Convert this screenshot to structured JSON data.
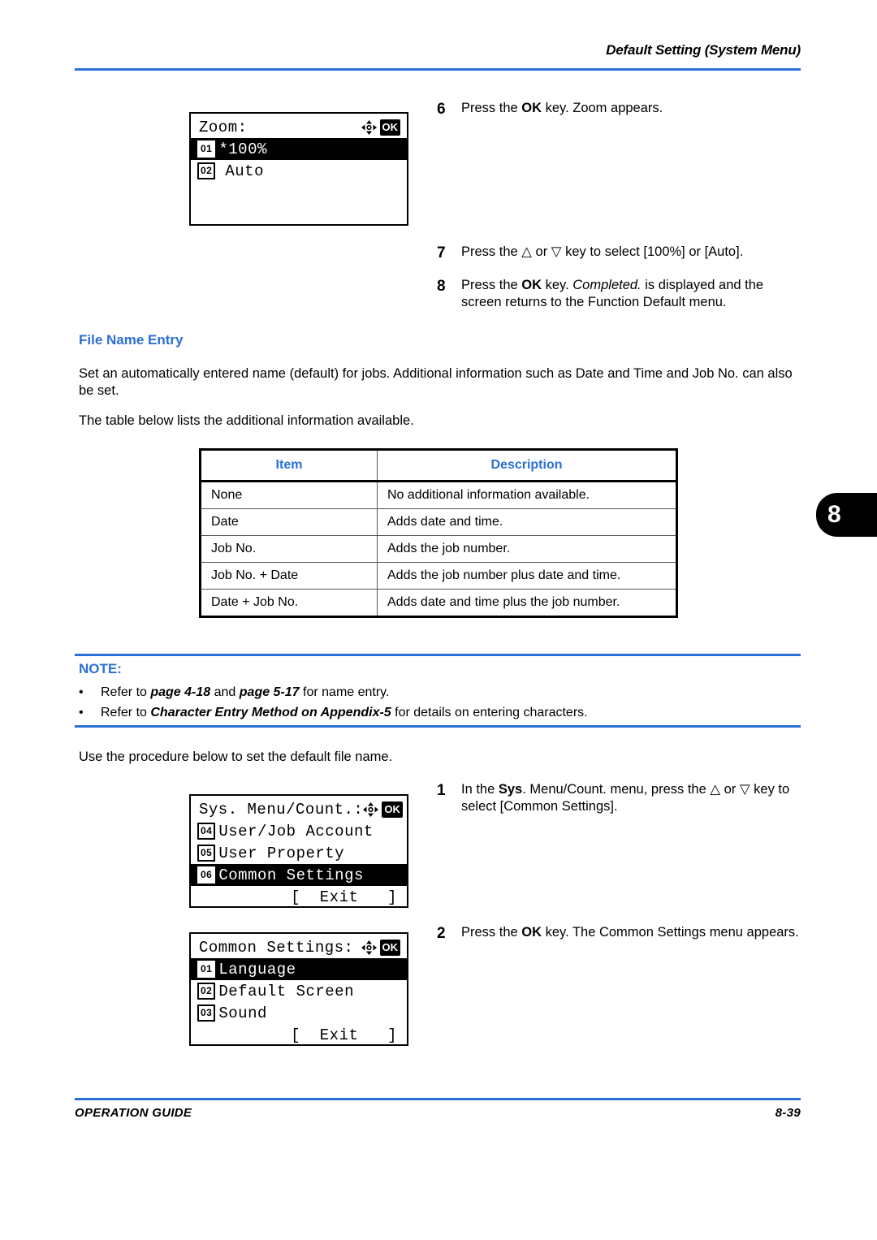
{
  "header": {
    "running_title": "Default Setting (System Menu)"
  },
  "chapter_tab": {
    "number": "8"
  },
  "lcd_zoom": {
    "title": "Zoom:",
    "nav_icon": "four-way-arrow-icon",
    "ok_label": "OK",
    "rows": [
      {
        "index": "01",
        "label": "*100%",
        "highlighted": true
      },
      {
        "index": "02",
        "label": "Auto",
        "highlighted": false
      }
    ]
  },
  "lcd_sys_menu": {
    "title": "Sys. Menu/Count.:",
    "nav_icon": "four-way-arrow-icon",
    "ok_label": "OK",
    "rows": [
      {
        "index": "04",
        "label": "User/Job Account",
        "highlighted": false
      },
      {
        "index": "05",
        "label": "User Property",
        "highlighted": false
      },
      {
        "index": "06",
        "label": "Common Settings",
        "highlighted": true
      }
    ],
    "exit_label": "[  Exit   ]"
  },
  "lcd_common_settings": {
    "title": "Common Settings:",
    "nav_icon": "four-way-arrow-icon",
    "ok_label": "OK",
    "rows": [
      {
        "index": "01",
        "label": "Language",
        "highlighted": true
      },
      {
        "index": "02",
        "label": "Default Screen",
        "highlighted": false
      },
      {
        "index": "03",
        "label": "Sound",
        "highlighted": false
      }
    ],
    "exit_label": "[  Exit   ]"
  },
  "steps_zoom": {
    "step6": {
      "num": "6",
      "pre": "Press the ",
      "bold": "OK",
      "post": " key. Zoom appears."
    },
    "step7": {
      "num": "7",
      "text": "Press the △ or ▽ key to select [100%] or [Auto]."
    },
    "step8": {
      "num": "8",
      "pre": "Press the ",
      "bold1": "OK",
      "mid": " key. ",
      "italic": "Completed.",
      "post": " is displayed and the screen returns to the Function Default menu."
    }
  },
  "section": {
    "title": "File Name Entry",
    "paragraph1": "Set an automatically entered name (default) for jobs. Additional information such as Date and Time and Job No. can also be set.",
    "paragraph2": "The table below lists the additional information available.",
    "paragraph3": "Use the procedure below to set the default file name."
  },
  "table": {
    "headers": [
      "Item",
      "Description"
    ],
    "rows": [
      [
        "None",
        "No additional information available."
      ],
      [
        "Date",
        "Adds date and time."
      ],
      [
        "Job No.",
        "Adds the job number."
      ],
      [
        "Job No. + Date",
        "Adds the job number plus date and time."
      ],
      [
        "Date + Job No.",
        "Adds date and time plus the job number."
      ]
    ]
  },
  "note": {
    "title": "NOTE:",
    "bullet": "•",
    "items": [
      {
        "pre": "Refer to ",
        "italic1": "page 4-18",
        "mid": " and ",
        "italic2": "page 5-17",
        "post": " for name entry."
      },
      {
        "pre": "Refer to ",
        "italic1": "Character Entry Method on Appendix-5",
        "mid": "",
        "italic2": "",
        "post": " for details on entering characters."
      }
    ]
  },
  "steps_filename": {
    "step1": {
      "num": "1",
      "pre": "In the ",
      "bold": "Sys",
      "post": ". Menu/Count. menu, press the △ or ▽ key to select [Common Settings]."
    },
    "step2": {
      "num": "2",
      "pre": "Press the ",
      "bold": "OK",
      "post": " key. The Common Settings menu appears."
    }
  },
  "footer": {
    "left": "OPERATION GUIDE",
    "right": "8-39"
  },
  "colors": {
    "accent_blue": "#2b6fd4",
    "black": "#000000",
    "white": "#ffffff"
  }
}
